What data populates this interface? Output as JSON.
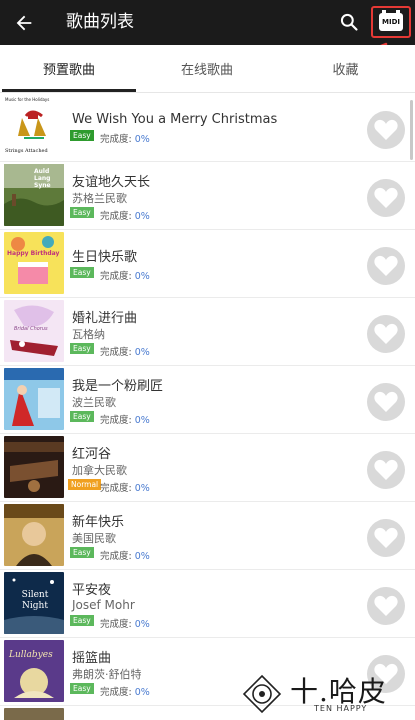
{
  "header": {
    "title": "歌曲列表",
    "back_icon": "arrow-left-icon",
    "search_icon": "search-icon",
    "midi_label": "MIDI",
    "bar_color": "#1b1b1b",
    "highlight_color": "#e53935"
  },
  "tabs": [
    {
      "label": "预置歌曲",
      "selected": true
    },
    {
      "label": "在线歌曲",
      "selected": false
    },
    {
      "label": "收藏",
      "selected": false
    }
  ],
  "progress_label": "完成度:",
  "songs": [
    {
      "title": "We Wish You a Merry Christmas",
      "artist": "",
      "level": "Easy",
      "progress": "0%",
      "cover_text": [
        "Music for the Holidays",
        "Strings Attached"
      ]
    },
    {
      "title": "友谊地久天长",
      "artist": "苏格兰民歌",
      "level": "Easy",
      "progress": "0%",
      "cover_text": [
        "Auld Lang Syne"
      ]
    },
    {
      "title": "生日快乐歌",
      "artist": "",
      "level": "Easy",
      "progress": "0%",
      "cover_text": [
        "Happy Birthday"
      ]
    },
    {
      "title": "婚礼进行曲",
      "artist": "瓦格纳",
      "level": "Easy",
      "progress": "0%",
      "cover_text": [
        "Bridal Chorus"
      ]
    },
    {
      "title": "我是一个粉刷匠",
      "artist": "波兰民歌",
      "level": "Easy",
      "progress": "0%",
      "cover_text": []
    },
    {
      "title": "红河谷",
      "artist": "加拿大民歌",
      "level": "Normal",
      "progress": "0%",
      "cover_text": []
    },
    {
      "title": "新年快乐",
      "artist": "美国民歌",
      "level": "Easy",
      "progress": "0%",
      "cover_text": []
    },
    {
      "title": "平安夜",
      "artist": "Josef Mohr",
      "level": "Easy",
      "progress": "0%",
      "cover_text": [
        "Silent Night"
      ]
    },
    {
      "title": "摇篮曲",
      "artist": "弗朗茨·舒伯特",
      "level": "Easy",
      "progress": "0%",
      "cover_text": [
        "Lullabyes"
      ]
    }
  ],
  "watermark": {
    "text": "十.哈皮",
    "sub": "TEN HAPPY"
  }
}
